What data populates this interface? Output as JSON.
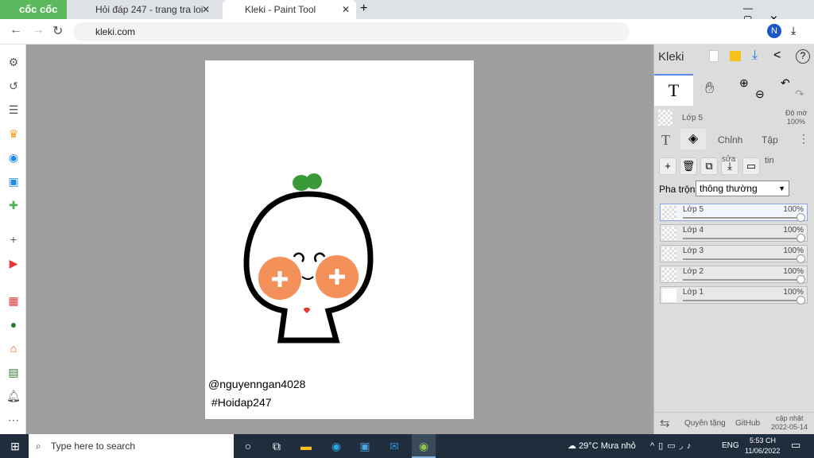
{
  "browser": {
    "brand": "cốc cốc",
    "tabs": [
      {
        "title": "Hỏi đáp 247 - trang tra loi"
      },
      {
        "title": "Kleki - Paint Tool"
      }
    ],
    "url": "kleki.com",
    "profile": "N"
  },
  "canvas": {
    "text1": "@nguyenngan4028",
    "text2": "#Hoidap247"
  },
  "panel": {
    "logo": "Kleki",
    "current_layer": "Lớp 5",
    "opacity_label": "Độ mờ",
    "opacity_value": "100%",
    "tabs": [
      "Chỉnh",
      "Tập"
    ],
    "tool_text": "T",
    "sua": "sửa",
    "tin": "tin",
    "blend_label": "Pha trộn",
    "blend_value": "thông thường",
    "layers": [
      {
        "name": "Lớp 5",
        "opacity": "100%"
      },
      {
        "name": "Lớp 4",
        "opacity": "100%"
      },
      {
        "name": "Lớp 3",
        "opacity": "100%"
      },
      {
        "name": "Lớp 2",
        "opacity": "100%"
      },
      {
        "name": "Lớp 1",
        "opacity": "100%"
      }
    ],
    "footer": {
      "donate": "Quyên tặng",
      "github": "GitHub",
      "update_label": "cập nhật",
      "update_date": "2022-05-14"
    }
  },
  "taskbar": {
    "search_placeholder": "Type here to search",
    "weather": "29°C  Mưa nhỏ",
    "lang": "ENG",
    "time": "5:53 CH",
    "date": "11/06/2022"
  }
}
